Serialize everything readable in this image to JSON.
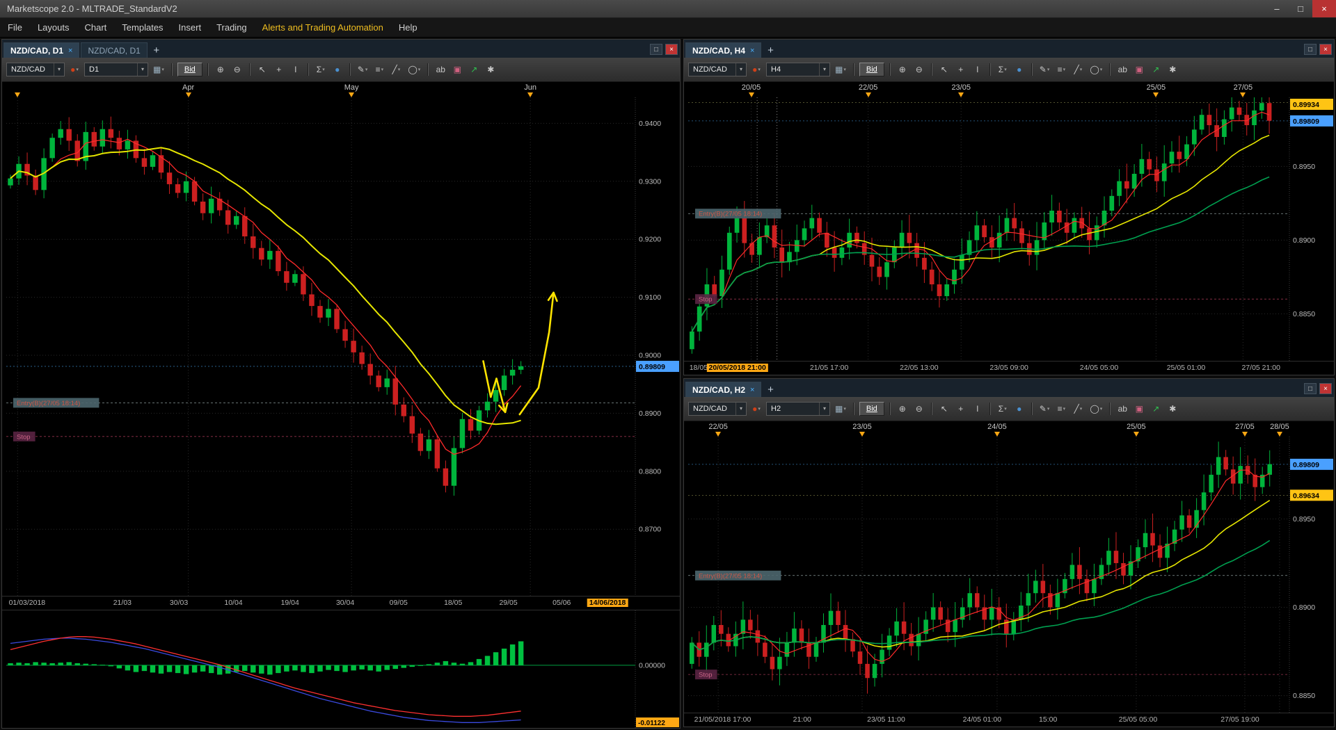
{
  "window": {
    "title": "Marketscope 2.0 - MLTRADE_StandardV2"
  },
  "icons": {
    "minimize": "–",
    "maximize": "□",
    "close": "×",
    "plus": "+",
    "dropdown": "▾",
    "tab_close": "×",
    "candle_style": "●",
    "chart_type": "▦",
    "panel_restore": "□",
    "panel_close": "×"
  },
  "menu": {
    "items": [
      {
        "label": "File"
      },
      {
        "label": "Layouts"
      },
      {
        "label": "Chart"
      },
      {
        "label": "Templates"
      },
      {
        "label": "Insert"
      },
      {
        "label": "Trading"
      },
      {
        "label": "Alerts and Trading Automation",
        "accent": true
      },
      {
        "label": "Help"
      }
    ]
  },
  "colors": {
    "up": "#00b43c",
    "down": "#cc2020",
    "ma_fast": "#ff2a2a",
    "ma_mid": "#e6e600",
    "ma_slow": "#00a050",
    "grid": "#2a2a2a",
    "axis_text": "#bdbdbd",
    "blue_label": "#4aa0ff",
    "yellow_label": "#ffc414",
    "orange_label": "#ffa814",
    "annotation": "#ffe400",
    "hist": "#00c040",
    "zero_line": "#00a040",
    "ind_blue": "#3a4adf",
    "ind_red": "#ff3030",
    "entry_bg": "#4c666e",
    "entry_text": "#cc5848",
    "stop_bg": "#5a2442",
    "stop_text": "#cc6688",
    "entry_line": "#8a9a9a",
    "stop_line": "#96344e"
  },
  "toolbar_tools": [
    {
      "name": "zoom-in-icon",
      "glyph": "⊕"
    },
    {
      "name": "zoom-out-icon",
      "glyph": "⊖"
    },
    {
      "name": "pointer-icon",
      "glyph": "↖"
    },
    {
      "name": "crosshair-icon",
      "glyph": "+"
    },
    {
      "name": "text-cursor-icon",
      "glyph": "I"
    },
    {
      "name": "indicators-icon",
      "glyph": "Σ",
      "dropdown": true
    },
    {
      "name": "globe-icon",
      "glyph": "●",
      "color": "#4a90d0"
    },
    {
      "name": "draw-pencil-icon",
      "glyph": "✎",
      "dropdown": true
    },
    {
      "name": "channel-icon",
      "glyph": "≡",
      "dropdown": true
    },
    {
      "name": "trendline-icon",
      "glyph": "╱",
      "dropdown": true
    },
    {
      "name": "ellipse-icon",
      "glyph": "◯",
      "dropdown": true
    },
    {
      "name": "text-label-icon",
      "glyph": "ab"
    },
    {
      "name": "eraser-icon",
      "glyph": "▣",
      "color": "#d06080"
    },
    {
      "name": "buy-arrow-icon",
      "glyph": "↗",
      "color": "#30c050"
    },
    {
      "name": "settings-icon",
      "glyph": "✱"
    }
  ],
  "panels": [
    {
      "id": "d1",
      "tabs": [
        {
          "label": "NZD/CAD, D1",
          "active": true,
          "closable": true
        },
        {
          "label": "NZD/CAD, D1",
          "active": false,
          "closable": false
        }
      ],
      "toolbar": {
        "symbol": "NZD/CAD",
        "timeframe": "D1",
        "bid": "Bid"
      },
      "top_axis": [
        {
          "label": "",
          "frac": 0.018
        },
        {
          "label": "Apr",
          "frac": 0.29
        },
        {
          "label": "May",
          "frac": 0.55
        },
        {
          "label": "Jun",
          "frac": 0.835
        }
      ],
      "bottom_axis": [
        {
          "label": "01/03/2018",
          "frac": 0.004,
          "align": "left"
        },
        {
          "label": "21/03",
          "frac": 0.185
        },
        {
          "label": "30/03",
          "frac": 0.275
        },
        {
          "label": "10/04",
          "frac": 0.362
        },
        {
          "label": "19/04",
          "frac": 0.452
        },
        {
          "label": "30/04",
          "frac": 0.54
        },
        {
          "label": "09/05",
          "frac": 0.625
        },
        {
          "label": "18/05",
          "frac": 0.712
        },
        {
          "label": "29/05",
          "frac": 0.8
        },
        {
          "label": "05/06",
          "frac": 0.885
        },
        {
          "label": "14/06/2018",
          "frac": 0.958,
          "highlight": true
        }
      ],
      "price_axis": {
        "range_max": 0.944,
        "range_min": 0.859,
        "labels": [
          0.94,
          0.93,
          0.92,
          0.91,
          0.9,
          0.89,
          0.88,
          0.87
        ],
        "decimals": 4
      },
      "current_prices": [
        {
          "text": "0.89809",
          "price": 0.89809,
          "style": "blue"
        }
      ],
      "entry": {
        "label": "Entry(B)(27/05 18:14)",
        "price": 0.8918
      },
      "stop": {
        "label": "Stop",
        "price": 0.886
      },
      "chart": {
        "slots": 75,
        "wick": 0.0016,
        "closes": [
          0.9305,
          0.933,
          0.931,
          0.9285,
          0.934,
          0.9375,
          0.939,
          0.937,
          0.9335,
          0.9385,
          0.936,
          0.939,
          0.9375,
          0.9355,
          0.937,
          0.934,
          0.9325,
          0.9345,
          0.9315,
          0.9295,
          0.928,
          0.93,
          0.9265,
          0.9245,
          0.927,
          0.925,
          0.9225,
          0.924,
          0.9205,
          0.9185,
          0.9165,
          0.918,
          0.9145,
          0.9125,
          0.914,
          0.9105,
          0.9085,
          0.9065,
          0.908,
          0.9045,
          0.9025,
          0.9005,
          0.8985,
          0.8965,
          0.8945,
          0.896,
          0.8915,
          0.8895,
          0.8865,
          0.8835,
          0.8855,
          0.8805,
          0.8775,
          0.884,
          0.889,
          0.887,
          0.8905,
          0.892,
          0.894,
          0.8965,
          0.8975,
          0.8981
        ],
        "mas": [
          {
            "period": 6,
            "color_key": "ma_fast",
            "width": 1.3
          },
          {
            "period": 15,
            "color_key": "ma_mid",
            "width": 2
          }
        ]
      },
      "annotations": [
        {
          "points": [
            [
              0.76,
              0.899
            ],
            [
              0.772,
              0.8928
            ],
            [
              0.781,
              0.896
            ],
            [
              0.795,
              0.8902
            ]
          ]
        },
        {
          "points": [
            [
              0.818,
              0.8898
            ],
            [
              0.848,
              0.8944
            ],
            [
              0.865,
              0.904
            ],
            [
              0.872,
              0.9108
            ]
          ]
        }
      ],
      "indicator": {
        "range_max": 0.01,
        "range_min": -0.0115,
        "zero_label": "0.00000",
        "bottom_label": "-0.01122",
        "hist": [
          0.0004,
          0.0005,
          0.0004,
          0.0006,
          0.0005,
          0.0004,
          0.0005,
          0.0006,
          0.0004,
          0.0003,
          0.0002,
          0.0001,
          -0.0002,
          -0.0006,
          -0.001,
          -0.0013,
          -0.0011,
          -0.0014,
          -0.0016,
          -0.0013,
          -0.0015,
          -0.0017,
          -0.0014,
          -0.0012,
          -0.0015,
          -0.0018,
          -0.0016,
          -0.0013,
          -0.0011,
          -0.0014,
          -0.0016,
          -0.0018,
          -0.0015,
          -0.0012,
          -0.001,
          -0.0013,
          -0.0015,
          -0.0012,
          -0.0009,
          -0.0011,
          -0.0013,
          -0.001,
          -0.0008,
          -0.001,
          -0.0012,
          -0.0009,
          -0.0007,
          -0.0005,
          -0.0003,
          -0.0001,
          0.0002,
          0.0005,
          0.0008,
          0.0005,
          0.0003,
          0.0006,
          0.0012,
          0.0018,
          0.0025,
          0.0032,
          0.004,
          0.0046
        ],
        "blue": [
          0.0042,
          0.0044,
          0.0046,
          0.0048,
          0.005,
          0.0051,
          0.0052,
          0.0052,
          0.0051,
          0.005,
          0.0048,
          0.0046,
          0.0044,
          0.0041,
          0.0038,
          0.0035,
          0.0032,
          0.0028,
          0.0024,
          0.002,
          0.0016,
          0.0012,
          0.0008,
          0.0004,
          0.0,
          -0.0004,
          -0.0009,
          -0.0014,
          -0.0019,
          -0.0024,
          -0.0029,
          -0.0034,
          -0.0039,
          -0.0044,
          -0.0049,
          -0.0054,
          -0.0059,
          -0.0064,
          -0.0068,
          -0.0072,
          -0.0076,
          -0.008,
          -0.0084,
          -0.0088,
          -0.0091,
          -0.0094,
          -0.0097,
          -0.01,
          -0.0102,
          -0.0104,
          -0.0106,
          -0.0107,
          -0.0108,
          -0.0109,
          -0.011,
          -0.011,
          -0.011,
          -0.0109,
          -0.0108,
          -0.0107,
          -0.0106,
          -0.0105
        ],
        "red": [
          0.003,
          0.0034,
          0.0038,
          0.0042,
          0.0046,
          0.0049,
          0.0052,
          0.0054,
          0.0055,
          0.0055,
          0.0054,
          0.0052,
          0.005,
          0.0047,
          0.0044,
          0.0041,
          0.0037,
          0.0033,
          0.0029,
          0.0025,
          0.0021,
          0.0017,
          0.0013,
          0.0009,
          0.0005,
          0.0001,
          -0.0004,
          -0.0009,
          -0.0014,
          -0.0019,
          -0.0024,
          -0.0029,
          -0.0034,
          -0.0039,
          -0.0044,
          -0.0048,
          -0.0052,
          -0.0056,
          -0.006,
          -0.0064,
          -0.0068,
          -0.0072,
          -0.0075,
          -0.0078,
          -0.0081,
          -0.0084,
          -0.0087,
          -0.0089,
          -0.0091,
          -0.0093,
          -0.0095,
          -0.0096,
          -0.0097,
          -0.0098,
          -0.0098,
          -0.0098,
          -0.0097,
          -0.0096,
          -0.0094,
          -0.0092,
          -0.009,
          -0.0088
        ]
      }
    },
    {
      "id": "h4",
      "tabs": [
        {
          "label": "NZD/CAD, H4",
          "active": true,
          "closable": true
        }
      ],
      "toolbar": {
        "symbol": "NZD/CAD",
        "timeframe": "H4",
        "bid": "Bid"
      },
      "top_axis": [
        {
          "label": "20/05",
          "frac": 0.105
        },
        {
          "label": "22/05",
          "frac": 0.3
        },
        {
          "label": "23/05",
          "frac": 0.455
        },
        {
          "label": "25/05",
          "frac": 0.78
        },
        {
          "label": "27/05",
          "frac": 0.925
        }
      ],
      "bottom_axis": [
        {
          "label": "18/05/2018",
          "frac": 0.002,
          "align": "left"
        },
        {
          "label": "20/05/2018 21:00",
          "frac": 0.082,
          "highlight": true
        },
        {
          "label": "21/05 17:00",
          "frac": 0.235
        },
        {
          "label": "22/05 13:00",
          "frac": 0.385
        },
        {
          "label": "23/05 09:00",
          "frac": 0.535
        },
        {
          "label": "24/05 05:00",
          "frac": 0.685
        },
        {
          "label": "25/05 01:00",
          "frac": 0.83
        },
        {
          "label": "27/05 21:00",
          "frac": 0.955
        }
      ],
      "price_axis": {
        "range_max": 0.8995,
        "range_min": 0.882,
        "labels": [
          0.895,
          0.89,
          0.885
        ],
        "decimals": 4
      },
      "current_prices": [
        {
          "text": "0.89934",
          "price": 0.89934,
          "style": "yellow"
        },
        {
          "text": "0.89809",
          "price": 0.89809,
          "style": "blue"
        }
      ],
      "entry": {
        "label": "Entry(B)(27/05 18:14)",
        "price": 0.8918
      },
      "stop": {
        "label": "Stop",
        "price": 0.886
      },
      "vlines": [
        {
          "frac": 0.115
        },
        {
          "frac": 0.148
        }
      ],
      "chart": {
        "slots": 80,
        "wick": 0.0009,
        "closes": [
          0.8838,
          0.8855,
          0.887,
          0.8862,
          0.888,
          0.8905,
          0.8915,
          0.8898,
          0.889,
          0.8902,
          0.891,
          0.8895,
          0.8885,
          0.8892,
          0.89,
          0.8908,
          0.8915,
          0.8905,
          0.8895,
          0.8888,
          0.8895,
          0.8905,
          0.8898,
          0.889,
          0.8882,
          0.8875,
          0.8885,
          0.8895,
          0.8905,
          0.8898,
          0.8888,
          0.888,
          0.887,
          0.8862,
          0.887,
          0.888,
          0.889,
          0.89,
          0.891,
          0.8902,
          0.8895,
          0.8905,
          0.8915,
          0.8908,
          0.8898,
          0.889,
          0.89,
          0.8912,
          0.892,
          0.8912,
          0.8905,
          0.8915,
          0.8908,
          0.89,
          0.891,
          0.892,
          0.893,
          0.894,
          0.8935,
          0.8945,
          0.8955,
          0.8948,
          0.894,
          0.8952,
          0.896,
          0.8955,
          0.8965,
          0.8975,
          0.8985,
          0.8978,
          0.897,
          0.8982,
          0.899,
          0.8985,
          0.8978,
          0.8988,
          0.8993,
          0.8981
        ],
        "mas": [
          {
            "period": 5,
            "color_key": "ma_fast",
            "width": 1.2
          },
          {
            "period": 18,
            "color_key": "ma_mid",
            "width": 1.6
          },
          {
            "period": 36,
            "color_key": "ma_slow",
            "width": 1.6
          }
        ]
      }
    },
    {
      "id": "h2",
      "tabs": [
        {
          "label": "NZD/CAD, H2",
          "active": true,
          "closable": true
        }
      ],
      "toolbar": {
        "symbol": "NZD/CAD",
        "timeframe": "H2",
        "bid": "Bid"
      },
      "top_axis": [
        {
          "label": "22/05",
          "frac": 0.05
        },
        {
          "label": "23/05",
          "frac": 0.29
        },
        {
          "label": "24/05",
          "frac": 0.515
        },
        {
          "label": "25/05",
          "frac": 0.747
        },
        {
          "label": "27/05",
          "frac": 0.928
        },
        {
          "label": "28/05",
          "frac": 0.986
        }
      ],
      "bottom_axis": [
        {
          "label": "21/05/2018 17:00",
          "frac": 0.01,
          "align": "left"
        },
        {
          "label": "21:00",
          "frac": 0.19
        },
        {
          "label": "23/05 11:00",
          "frac": 0.33
        },
        {
          "label": "24/05 01:00",
          "frac": 0.49
        },
        {
          "label": "15:00",
          "frac": 0.6
        },
        {
          "label": "25/05 05:00",
          "frac": 0.75
        },
        {
          "label": "27/05 19:00",
          "frac": 0.92
        }
      ],
      "price_axis": {
        "range_max": 0.8995,
        "range_min": 0.8842,
        "labels": [
          0.895,
          0.89,
          0.885
        ],
        "decimals": 4
      },
      "current_prices": [
        {
          "text": "0.89809",
          "price": 0.89809,
          "style": "blue"
        },
        {
          "text": "0.89634",
          "price": 0.89634,
          "style": "yellow"
        }
      ],
      "entry": {
        "label": "Entry(B)(27/05 18:14)",
        "price": 0.8918
      },
      "stop": {
        "label": "Stop",
        "price": 0.8862
      },
      "chart": {
        "slots": 82,
        "wick": 0.0008,
        "closes": [
          0.888,
          0.8872,
          0.888,
          0.889,
          0.8885,
          0.8878,
          0.8885,
          0.8893,
          0.8887,
          0.888,
          0.8872,
          0.8865,
          0.8872,
          0.888,
          0.8888,
          0.888,
          0.8872,
          0.888,
          0.889,
          0.8898,
          0.889,
          0.8882,
          0.8875,
          0.8868,
          0.886,
          0.8868,
          0.8876,
          0.8884,
          0.8892,
          0.8885,
          0.8878,
          0.8885,
          0.8893,
          0.89,
          0.8893,
          0.8886,
          0.8893,
          0.89,
          0.8908,
          0.89,
          0.8893,
          0.89,
          0.8893,
          0.8885,
          0.8893,
          0.8901,
          0.8908,
          0.8915,
          0.8908,
          0.89,
          0.8908,
          0.8916,
          0.8924,
          0.8916,
          0.8908,
          0.8916,
          0.8924,
          0.8932,
          0.8925,
          0.8918,
          0.8926,
          0.8934,
          0.8942,
          0.8935,
          0.8928,
          0.8936,
          0.8944,
          0.8952,
          0.8945,
          0.8955,
          0.8965,
          0.8975,
          0.8985,
          0.8978,
          0.897,
          0.898,
          0.8975,
          0.8968,
          0.8975,
          0.8981
        ],
        "mas": [
          {
            "period": 5,
            "color_key": "ma_fast",
            "width": 1.2
          },
          {
            "period": 18,
            "color_key": "ma_mid",
            "width": 1.6
          },
          {
            "period": 36,
            "color_key": "ma_slow",
            "width": 1.6
          }
        ]
      }
    }
  ]
}
